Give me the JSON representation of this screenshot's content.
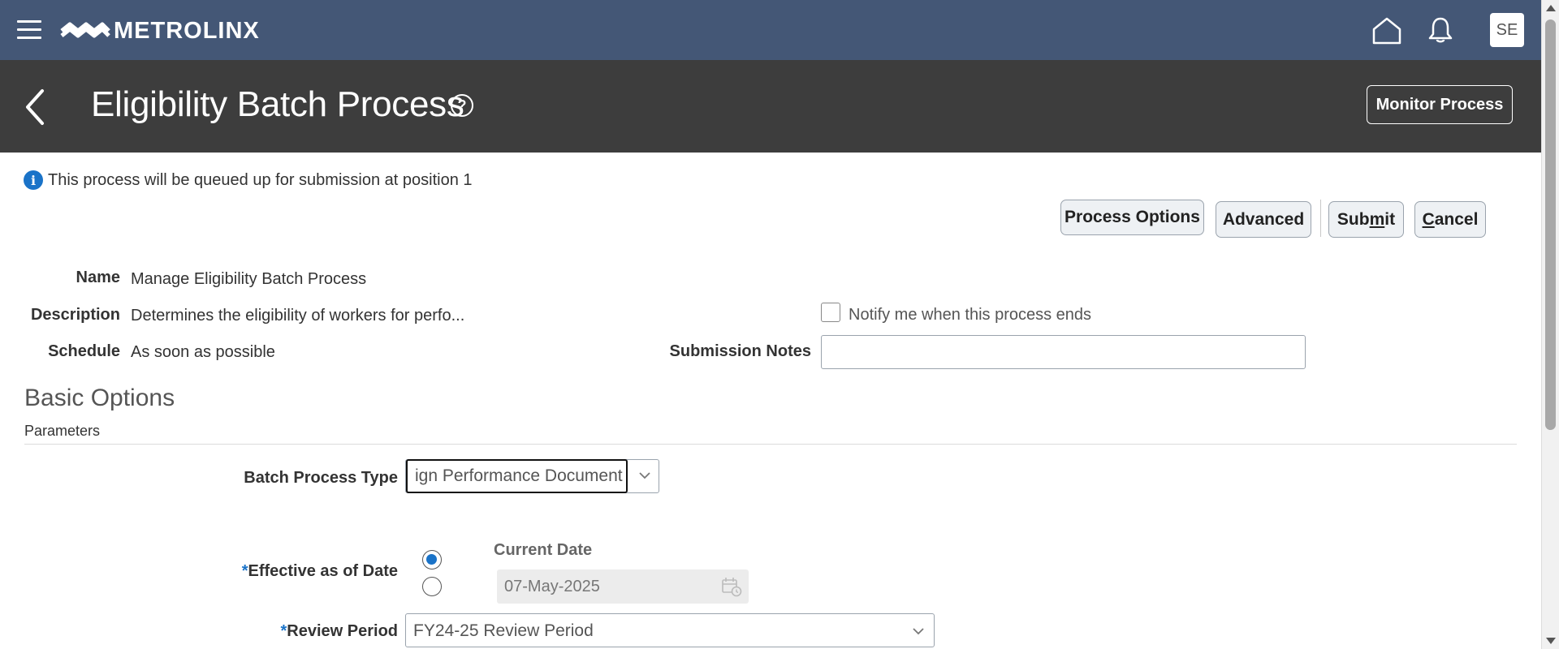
{
  "header": {
    "brand": "METROLINX",
    "avatar_initials": "SE",
    "icons": [
      "menu-icon",
      "home-icon",
      "bell-icon"
    ]
  },
  "page": {
    "title": "Eligibility Batch Process",
    "help_glyph": "?",
    "monitor_button": "Monitor Process"
  },
  "info": {
    "glyph": "i",
    "message": "This process will be queued up for submission at position 1"
  },
  "actions": {
    "process_options": "Process Options",
    "advanced": "Advanced",
    "submit_pre": "Sub",
    "submit_underline": "m",
    "submit_post": "it",
    "cancel_underline": "C",
    "cancel_post": "ancel"
  },
  "details": {
    "name_label": "Name",
    "name_value": "Manage Eligibility Batch Process",
    "description_label": "Description",
    "description_value": "Determines the eligibility of workers for perfo...",
    "schedule_label": "Schedule",
    "schedule_value": "As soon as possible",
    "notify_label": "Notify me when this process ends",
    "notify_checked": false,
    "submission_notes_label": "Submission Notes",
    "submission_notes_value": ""
  },
  "basic_options": {
    "title": "Basic Options",
    "parameters_label": "Parameters",
    "batch_process_type_label": "Batch Process Type",
    "batch_process_type_value": "ign Performance Document",
    "effective_date_required": "*",
    "effective_date_label": "Effective as of Date",
    "current_date_label": "Current Date",
    "date_value": "07-May-2025",
    "selected_option": "Current Date",
    "review_period_required": "*",
    "review_period_label": "Review Period",
    "review_period_value": "FY24-25 Review Period"
  },
  "colors": {
    "topbar": "#445776",
    "pagebar": "#3d3d3d",
    "accent": "#1a73c8"
  }
}
